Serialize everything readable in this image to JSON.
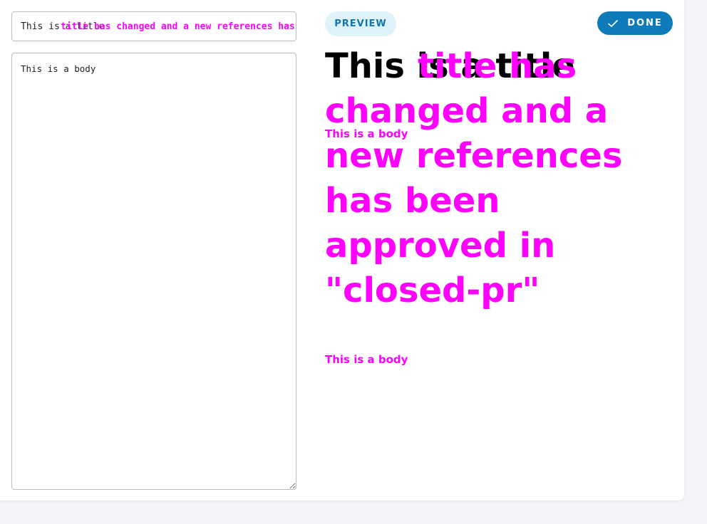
{
  "editor": {
    "title_value_base": "This is a title",
    "title_value_overlay": "title has changed and a new references has been approved in \"closed-pr\"",
    "body_value": "This is a body"
  },
  "toolbar": {
    "preview_label": "PREVIEW",
    "done_label": "DONE"
  },
  "preview": {
    "title_base": "This is a title",
    "title_overlay": "title has changed and a new references has been approved in \"closed-pr\"",
    "body_first": "This is a body",
    "body_second": "This is a body"
  },
  "colors": {
    "accent": "#0f7ab8",
    "preview_bg": "#def2fb",
    "overlay": "#ff00ff"
  },
  "icons": {
    "done": "checkmark-icon"
  }
}
